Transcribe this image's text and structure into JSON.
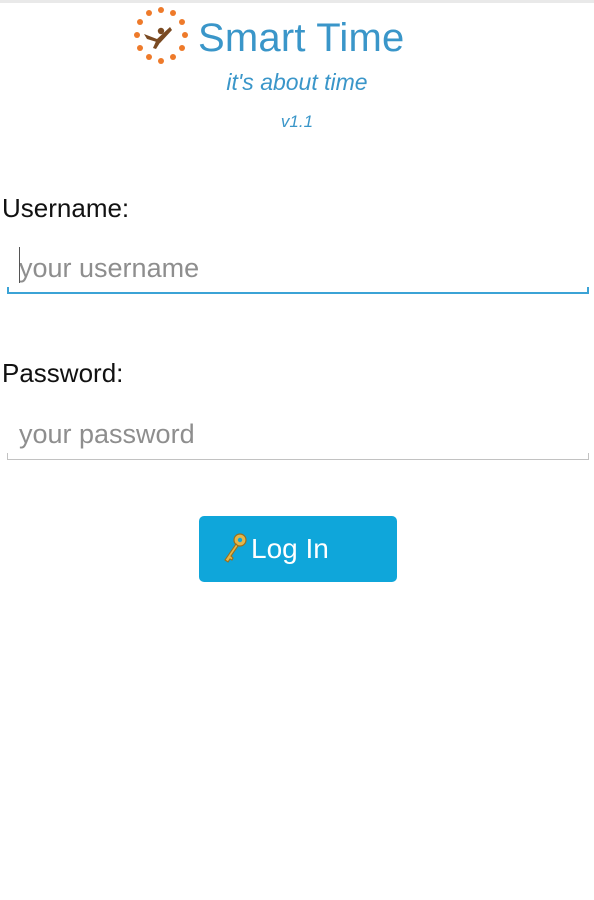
{
  "app": {
    "title": "Smart Time",
    "tagline": "it's about time",
    "version": "v1.1",
    "logo_icon": "clock-person-icon",
    "brand_color": "#3a96c9",
    "logo_accent_color": "#ee7a2a"
  },
  "form": {
    "username": {
      "label": "Username:",
      "placeholder": "your username",
      "value": "",
      "focused": true
    },
    "password": {
      "label": "Password:",
      "placeholder": "your password",
      "value": "",
      "focused": false
    },
    "active_color": "#3ba3d6"
  },
  "login_button": {
    "label": "Log In",
    "icon": "key-icon",
    "color": "#0fa6da"
  }
}
